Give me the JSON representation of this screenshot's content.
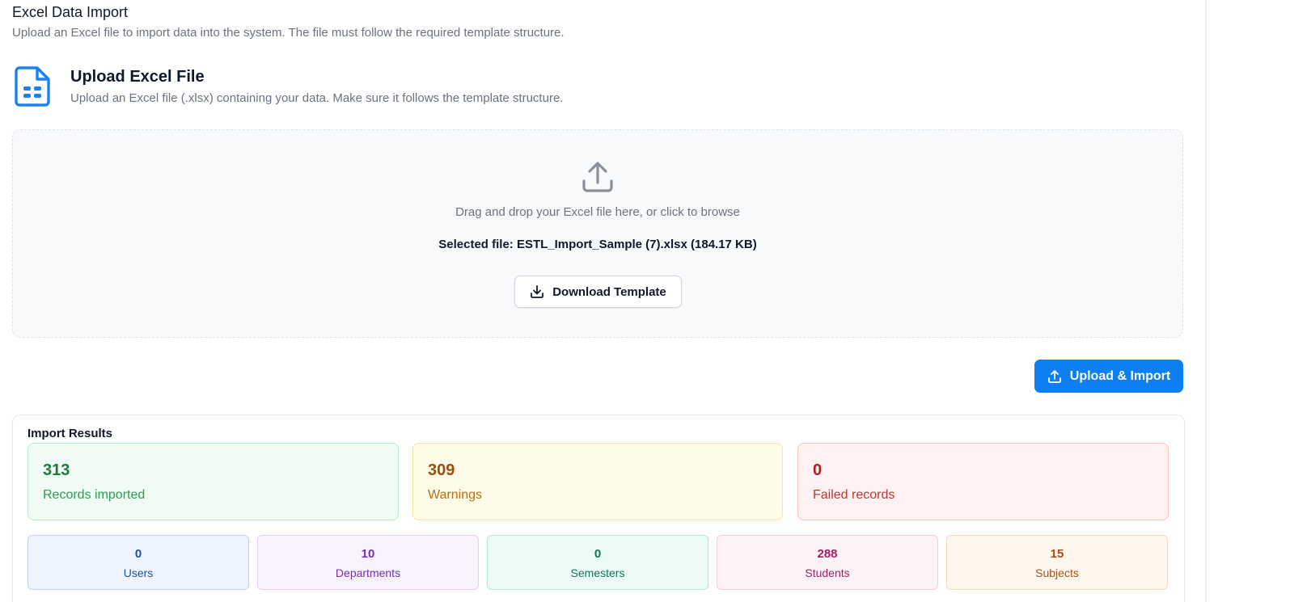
{
  "header": {
    "title": "Excel Data Import",
    "subtitle": "Upload an Excel file to import data into the system. The file must follow the required template structure."
  },
  "upload_section": {
    "icon": "file-spreadsheet-icon",
    "title": "Upload Excel File",
    "subtitle": "Upload an Excel file (.xlsx) containing your data. Make sure it follows the template structure."
  },
  "dropzone": {
    "icon": "upload-icon",
    "instruction": "Drag and drop your Excel file here, or click to browse",
    "selected_file": "Selected file: ESTL_Import_Sample (7).xlsx (184.17 KB)",
    "download_template_label": "Download Template"
  },
  "actions": {
    "upload_import_label": "Upload & Import",
    "accent_color": "#0d7ff0"
  },
  "results": {
    "title": "Import Results",
    "summary": [
      {
        "value": "313",
        "label": "Records imported",
        "tone": "green"
      },
      {
        "value": "309",
        "label": "Warnings",
        "tone": "yellow"
      },
      {
        "value": "0",
        "label": "Failed records",
        "tone": "red"
      }
    ],
    "entities": [
      {
        "value": "0",
        "label": "Users"
      },
      {
        "value": "10",
        "label": "Departments"
      },
      {
        "value": "0",
        "label": "Semesters"
      },
      {
        "value": "288",
        "label": "Students"
      },
      {
        "value": "15",
        "label": "Subjects"
      }
    ]
  }
}
